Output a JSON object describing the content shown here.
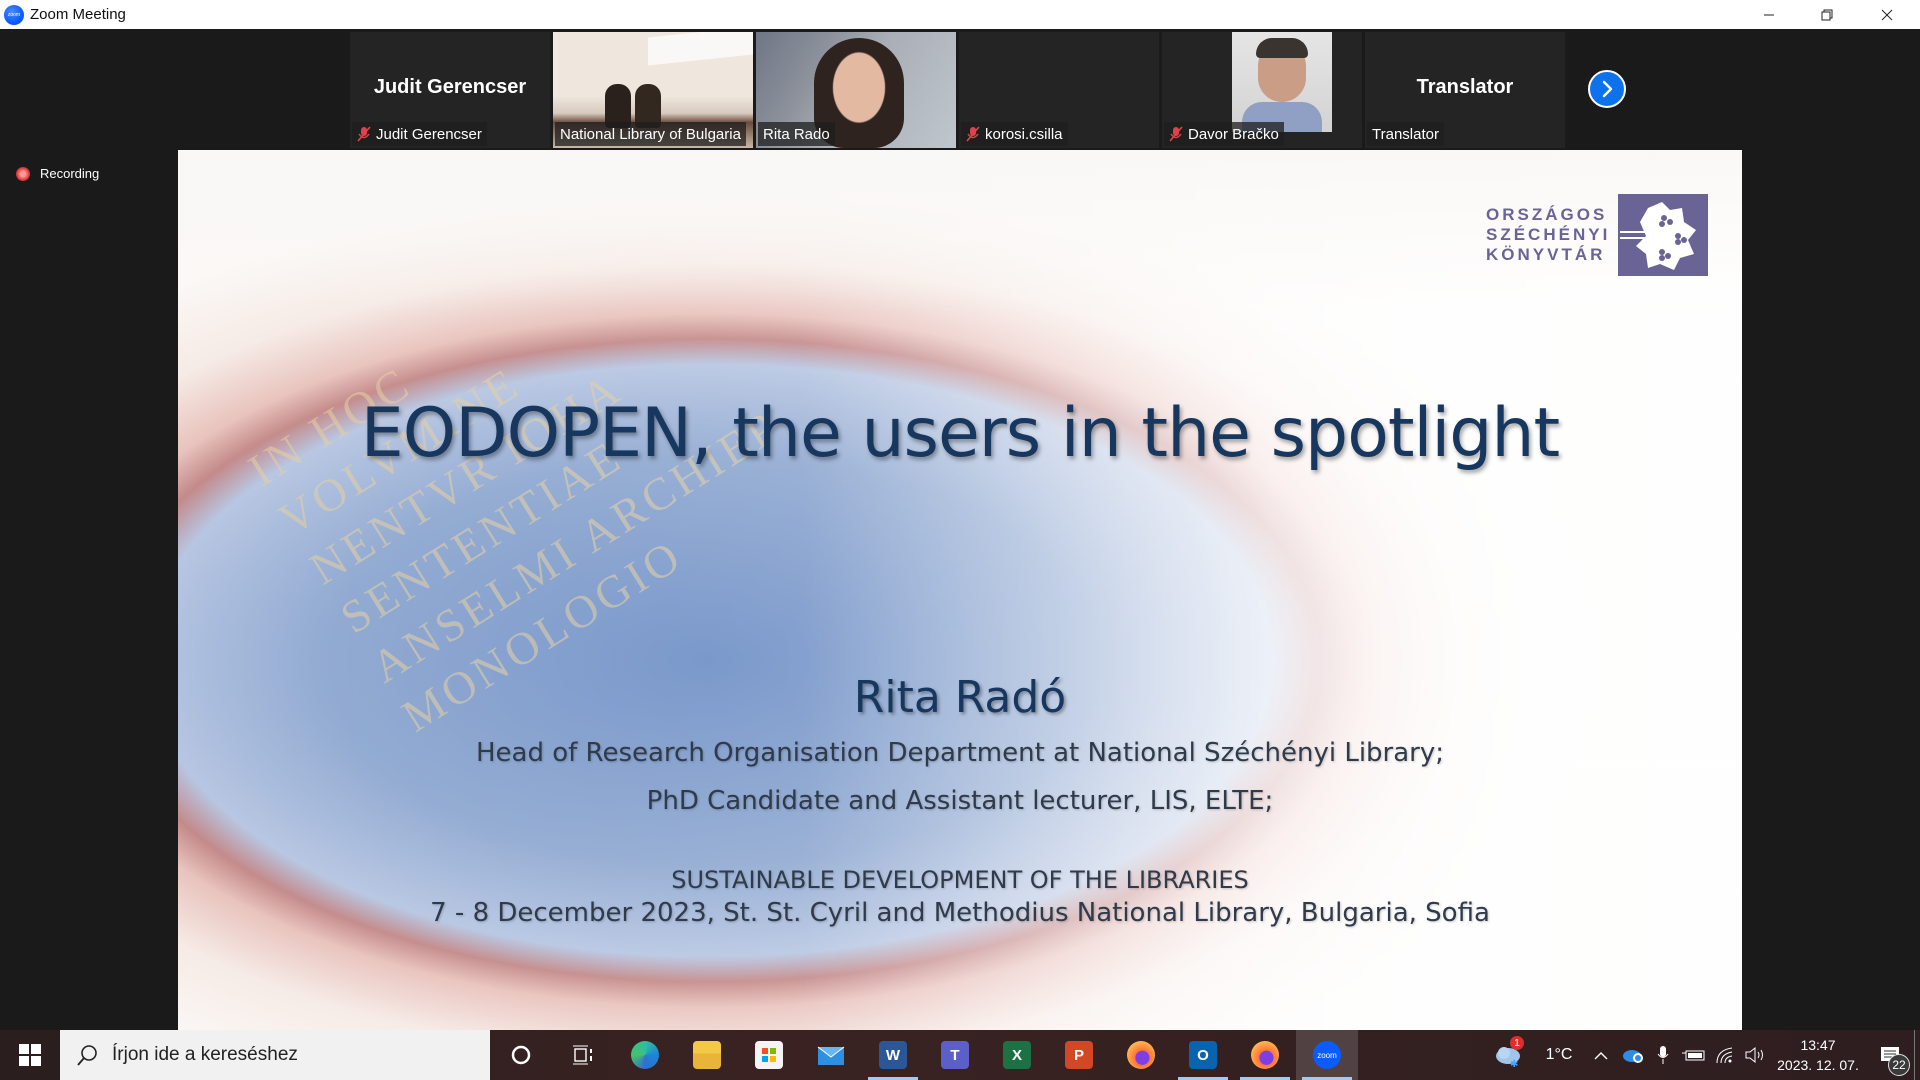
{
  "window": {
    "title": "Zoom Meeting",
    "controls": {
      "minimize": "minimize",
      "maximize": "restore",
      "close": "close"
    }
  },
  "participants": [
    {
      "big_name": "Judit Gerencser",
      "label": "Judit Gerencser",
      "muted": true,
      "video": false
    },
    {
      "big_name": "",
      "label": "National Library of Bulgaria",
      "muted": false,
      "video": true
    },
    {
      "big_name": "",
      "label": "Rita Rado",
      "muted": false,
      "video": true,
      "active_speaker": true
    },
    {
      "big_name": "",
      "label": "korosi.csilla",
      "muted": true,
      "video": false
    },
    {
      "big_name": "",
      "label": "Davor Bračko",
      "muted": true,
      "video": false,
      "profile_photo": true
    },
    {
      "big_name": "Translator",
      "label": "Translator",
      "muted": false,
      "video": false
    }
  ],
  "strip": {
    "next_page_icon": "chevron-right-icon"
  },
  "recording": {
    "label": "Recording"
  },
  "slide": {
    "logo_lines": [
      "ORSZÁGOS",
      "SZÉCHÉNYI",
      "KÖNYVTÁR"
    ],
    "background_latin": "IN HOC\nVOLVMINE\nNENTVR IOHA\nSENTENTIAE\nANSELMI ARCHIEP\nMONOLOGIO",
    "title": "EODOPEN, the users in the spotlight",
    "author": "Rita Radó",
    "role1": "Head of Research Organisation Department at National Széchényi Library;",
    "role2": "PhD Candidate and Assistant lecturer, LIS, ELTE;",
    "conference": "SUSTAINABLE DEVELOPMENT OF THE LIBRARIES",
    "date_venue": "7 - 8 December 2023, St. St. Cyril and Methodius National Library, Bulgaria, Sofia"
  },
  "taskbar": {
    "search_placeholder": "Írjon ide a kereséshez",
    "apps": [
      {
        "name": "cortana",
        "label": ""
      },
      {
        "name": "task-view",
        "label": ""
      },
      {
        "name": "edge",
        "label": ""
      },
      {
        "name": "file-explorer",
        "label": ""
      },
      {
        "name": "microsoft-store",
        "label": ""
      },
      {
        "name": "mail",
        "label": ""
      },
      {
        "name": "word",
        "label": "W"
      },
      {
        "name": "teams",
        "label": "T"
      },
      {
        "name": "excel",
        "label": "X"
      },
      {
        "name": "powerpoint",
        "label": "P"
      },
      {
        "name": "firefox",
        "label": ""
      },
      {
        "name": "outlook",
        "label": "O"
      },
      {
        "name": "firefox-2",
        "label": ""
      },
      {
        "name": "zoom",
        "label": "zoom"
      }
    ],
    "weather": {
      "temp": "1°C",
      "badge": "1"
    },
    "clock": {
      "time": "13:47",
      "date": "2023. 12. 07."
    },
    "notifications_count": "22"
  },
  "colors": {
    "zoom_blue": "#0e72ed",
    "active_speaker": "#7bc047",
    "slide_title": "#17375e",
    "logo_purple": "#6a6496",
    "muted_red": "#e0424a"
  }
}
